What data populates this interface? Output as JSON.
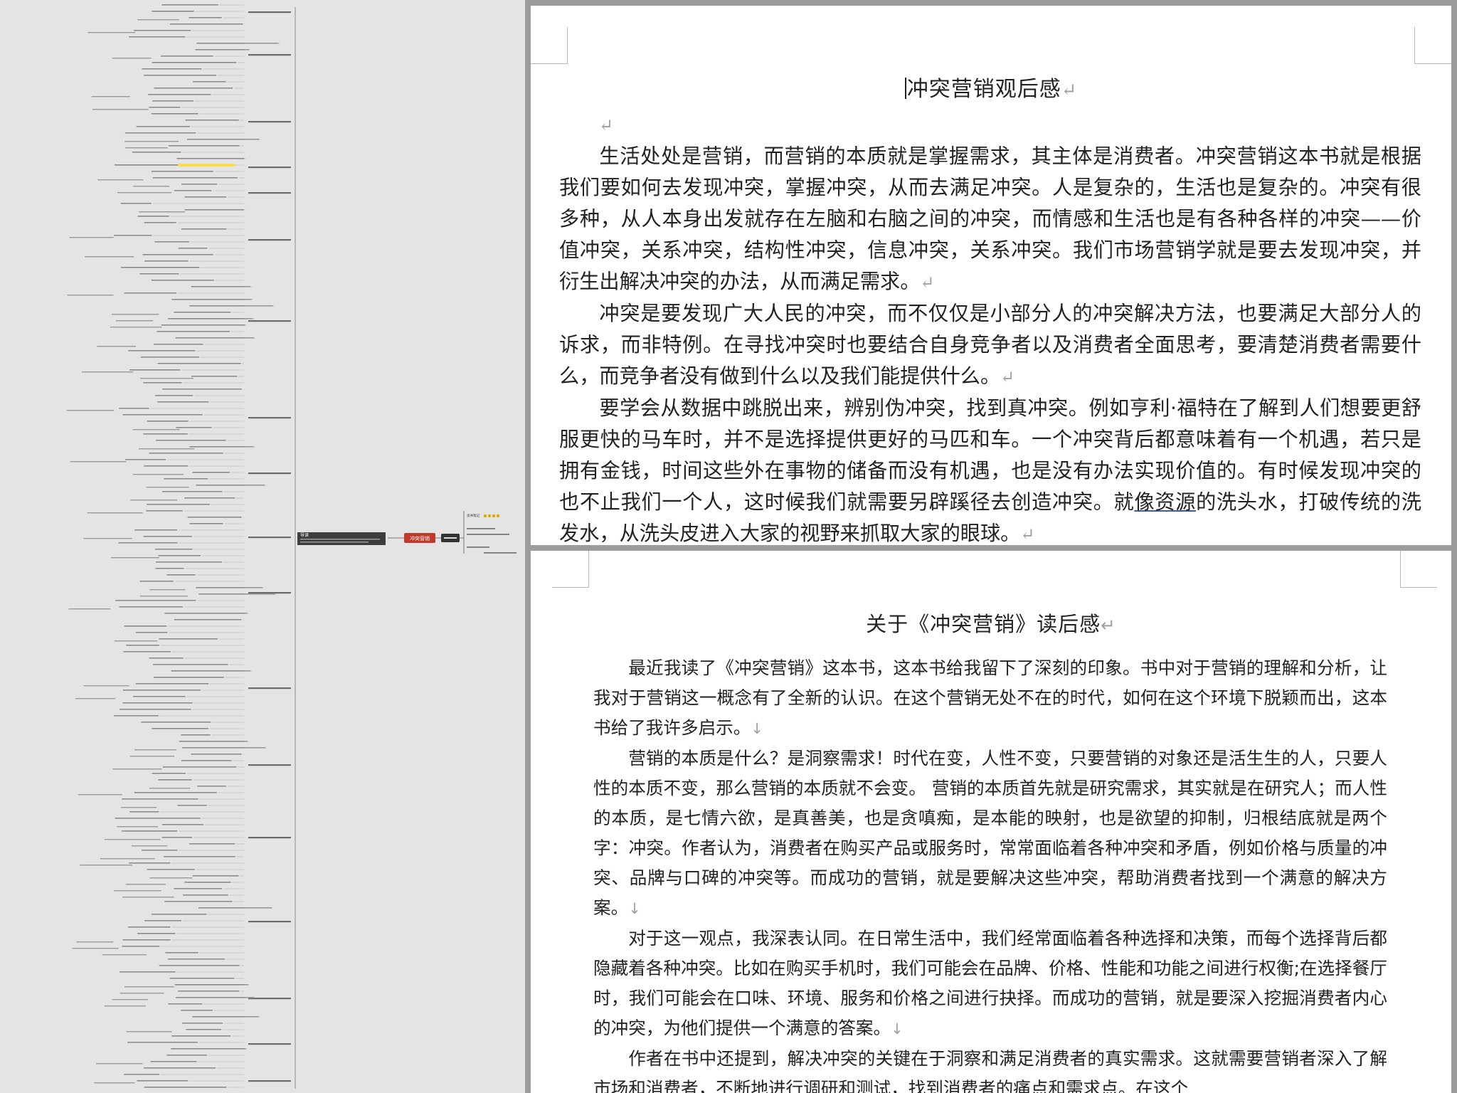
{
  "mindmap": {
    "root_label": "冲突营销",
    "center_note_title": "导读",
    "right_head": "读书笔记"
  },
  "page1": {
    "title": "冲突营销观后感",
    "paragraphs": [
      "生活处处是营销，而营销的本质就是掌握需求，其主体是消费者。冲突营销这本书就是根据我们要如何去发现冲突，掌握冲突，从而去满足冲突。人是复杂的，生活也是复杂的。冲突有很多种，从人本身出发就存在左脑和右脑之间的冲突，而情感和生活也是有各种各样的冲突——价值冲突，关系冲突，结构性冲突，信息冲突，关系冲突。我们市场营销学就是要去发现冲突，并衍生出解决冲突的办法，从而满足需求。",
      "冲突是要发现广大人民的冲突，而不仅仅是小部分人的冲突解决方法，也要满足大部分人的诉求，而非特例。在寻找冲突时也要结合自身竞争者以及消费者全面思考，要清楚消费者需要什么，而竞争者没有做到什么以及我们能提供什么。"
    ],
    "para3_before": "要学会从数据中跳脱出来，辨别伪冲突，找到真冲突。例如亨利·福特在了解到人们想要更舒服更快的马车时，并不是选择提供更好的马匹和车。一个冲突背后都意味着有一个机遇，若只是拥有金钱，时间这些外在事物的储备而没有机遇，也是没有办法实现价值的。有时候发现冲突的也不止我们一个人，这时候我们就需要另辟蹊径去创造冲突。就",
    "para3_link": "像资源",
    "para3_after": "的洗头水，打破传统的洗发水，从洗头皮进入大家的视野来抓取大家的眼球。"
  },
  "page2": {
    "title": "关于《冲突营销》读后感",
    "paragraphs": [
      "最近我读了《冲突营销》这本书，这本书给我留下了深刻的印象。书中对于营销的理解和分析，让我对于营销这一概念有了全新的认识。在这个营销无处不在的时代，如何在这个环境下脱颖而出，这本书给了我许多启示。",
      "营销的本质是什么？是洞察需求！时代在变，人性不变，只要营销的对象还是活生生的人，只要人性的本质不变，那么营销的本质就不会变。 营销的本质首先就是研究需求，其实就是在研究人；而人性的本质，是七情六欲，是真善美，也是贪嗔痴，是本能的映射，也是欲望的抑制，归根结底就是两个字：冲突。作者认为，消费者在购买产品或服务时，常常面临着各种冲突和矛盾，例如价格与质量的冲突、品牌与口碑的冲突等。而成功的营销，就是要解决这些冲突，帮助消费者找到一个满意的解决方案。",
      "对于这一观点，我深表认同。在日常生活中，我们经常面临着各种选择和决策，而每个选择背后都隐藏着各种冲突。比如在购买手机时，我们可能会在品牌、价格、性能和功能之间进行权衡;在选择餐厅时，我们可能会在口味、环境、服务和价格之间进行抉择。而成功的营销，就是要深入挖掘消费者内心的冲突，为他们提供一个满意的答案。",
      "作者在书中还提到，解决冲突的关键在于洞察和满足消费者的真实需求。这就需要营销者深入了解市场和消费者，不断地进行调研和测试，找到消费者的痛点和需求点。在这个"
    ]
  }
}
